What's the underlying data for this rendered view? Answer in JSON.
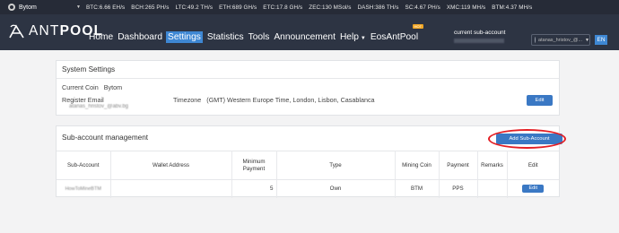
{
  "ticker": {
    "coin": "Bytom",
    "items": [
      "BTC:6.66 EH/s",
      "BCH:265 PH/s",
      "LTC:49.2 TH/s",
      "ETH:689 GH/s",
      "ETC:17.8 GH/s",
      "ZEC:130 MSol/s",
      "DASH:386 TH/s",
      "SC:4.67 PH/s",
      "XMC:119 MH/s",
      "BTM:4.37 MH/s"
    ]
  },
  "nav": {
    "logo_a": "ANT",
    "logo_b": "POOL",
    "items": [
      "Home",
      "Dashboard",
      "Settings",
      "Statistics",
      "Tools",
      "Announcement",
      "Help",
      "EosAntPool"
    ],
    "hot_badge": "HOT",
    "sub_account_label": "current sub-account",
    "user_name": "atanas_hristov_@...",
    "lang": "EN"
  },
  "system": {
    "title": "System Settings",
    "current_coin_label": "Current Coin",
    "current_coin_value": "Bytom",
    "register_email_label": "Register Email",
    "register_email_value": "atanas_hristov_@abv.bg",
    "timezone_label": "Timezone",
    "timezone_value": "(GMT) Western Europe Time, London, Lisbon, Casablanca",
    "edit_label": "Edit"
  },
  "subaccount": {
    "title": "Sub-account management",
    "add_label": "Add Sub-Account",
    "headers": [
      "Sub-Account",
      "Wallet Address",
      "Minimum Payment",
      "Type",
      "Mining Coin",
      "Payment",
      "Remarks",
      "Edit"
    ],
    "rows": [
      {
        "sub_account": "HowToMineBTM",
        "wallet": "",
        "min_payment": "5",
        "type": "Own",
        "coin": "BTM",
        "payment": "PPS",
        "remarks": "",
        "edit": "Edit"
      }
    ]
  }
}
